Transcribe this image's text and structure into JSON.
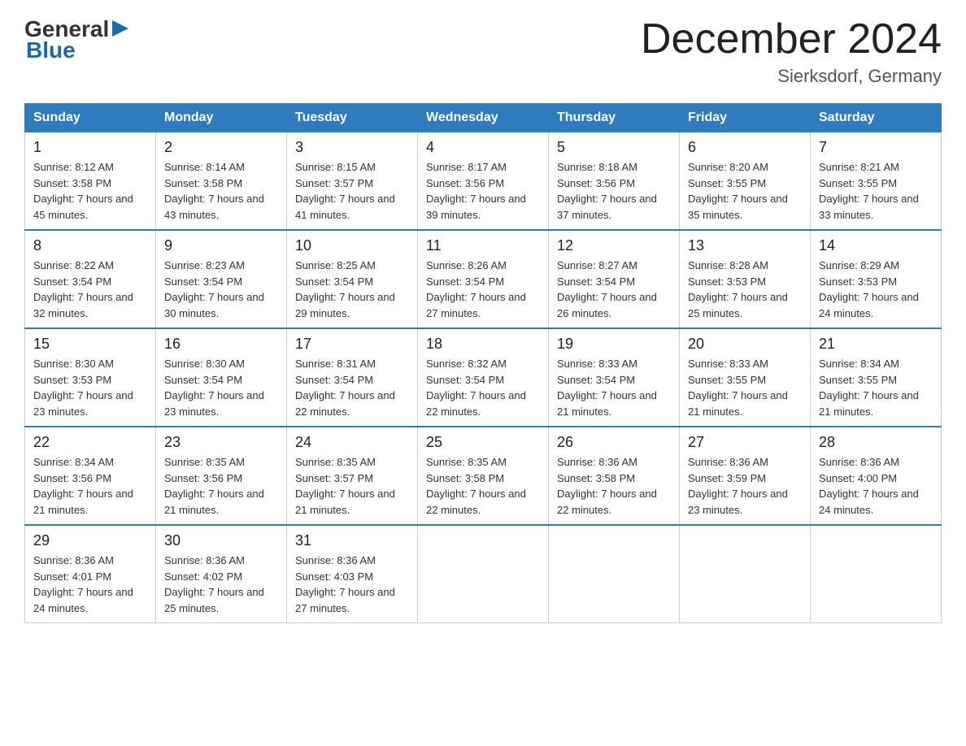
{
  "header": {
    "logo_general": "General",
    "logo_blue": "Blue",
    "title": "December 2024",
    "subtitle": "Sierksdorf, Germany"
  },
  "days_of_week": [
    "Sunday",
    "Monday",
    "Tuesday",
    "Wednesday",
    "Thursday",
    "Friday",
    "Saturday"
  ],
  "weeks": [
    [
      {
        "day": "1",
        "sunrise": "8:12 AM",
        "sunset": "3:58 PM",
        "daylight": "7 hours and 45 minutes."
      },
      {
        "day": "2",
        "sunrise": "8:14 AM",
        "sunset": "3:58 PM",
        "daylight": "7 hours and 43 minutes."
      },
      {
        "day": "3",
        "sunrise": "8:15 AM",
        "sunset": "3:57 PM",
        "daylight": "7 hours and 41 minutes."
      },
      {
        "day": "4",
        "sunrise": "8:17 AM",
        "sunset": "3:56 PM",
        "daylight": "7 hours and 39 minutes."
      },
      {
        "day": "5",
        "sunrise": "8:18 AM",
        "sunset": "3:56 PM",
        "daylight": "7 hours and 37 minutes."
      },
      {
        "day": "6",
        "sunrise": "8:20 AM",
        "sunset": "3:55 PM",
        "daylight": "7 hours and 35 minutes."
      },
      {
        "day": "7",
        "sunrise": "8:21 AM",
        "sunset": "3:55 PM",
        "daylight": "7 hours and 33 minutes."
      }
    ],
    [
      {
        "day": "8",
        "sunrise": "8:22 AM",
        "sunset": "3:54 PM",
        "daylight": "7 hours and 32 minutes."
      },
      {
        "day": "9",
        "sunrise": "8:23 AM",
        "sunset": "3:54 PM",
        "daylight": "7 hours and 30 minutes."
      },
      {
        "day": "10",
        "sunrise": "8:25 AM",
        "sunset": "3:54 PM",
        "daylight": "7 hours and 29 minutes."
      },
      {
        "day": "11",
        "sunrise": "8:26 AM",
        "sunset": "3:54 PM",
        "daylight": "7 hours and 27 minutes."
      },
      {
        "day": "12",
        "sunrise": "8:27 AM",
        "sunset": "3:54 PM",
        "daylight": "7 hours and 26 minutes."
      },
      {
        "day": "13",
        "sunrise": "8:28 AM",
        "sunset": "3:53 PM",
        "daylight": "7 hours and 25 minutes."
      },
      {
        "day": "14",
        "sunrise": "8:29 AM",
        "sunset": "3:53 PM",
        "daylight": "7 hours and 24 minutes."
      }
    ],
    [
      {
        "day": "15",
        "sunrise": "8:30 AM",
        "sunset": "3:53 PM",
        "daylight": "7 hours and 23 minutes."
      },
      {
        "day": "16",
        "sunrise": "8:30 AM",
        "sunset": "3:54 PM",
        "daylight": "7 hours and 23 minutes."
      },
      {
        "day": "17",
        "sunrise": "8:31 AM",
        "sunset": "3:54 PM",
        "daylight": "7 hours and 22 minutes."
      },
      {
        "day": "18",
        "sunrise": "8:32 AM",
        "sunset": "3:54 PM",
        "daylight": "7 hours and 22 minutes."
      },
      {
        "day": "19",
        "sunrise": "8:33 AM",
        "sunset": "3:54 PM",
        "daylight": "7 hours and 21 minutes."
      },
      {
        "day": "20",
        "sunrise": "8:33 AM",
        "sunset": "3:55 PM",
        "daylight": "7 hours and 21 minutes."
      },
      {
        "day": "21",
        "sunrise": "8:34 AM",
        "sunset": "3:55 PM",
        "daylight": "7 hours and 21 minutes."
      }
    ],
    [
      {
        "day": "22",
        "sunrise": "8:34 AM",
        "sunset": "3:56 PM",
        "daylight": "7 hours and 21 minutes."
      },
      {
        "day": "23",
        "sunrise": "8:35 AM",
        "sunset": "3:56 PM",
        "daylight": "7 hours and 21 minutes."
      },
      {
        "day": "24",
        "sunrise": "8:35 AM",
        "sunset": "3:57 PM",
        "daylight": "7 hours and 21 minutes."
      },
      {
        "day": "25",
        "sunrise": "8:35 AM",
        "sunset": "3:58 PM",
        "daylight": "7 hours and 22 minutes."
      },
      {
        "day": "26",
        "sunrise": "8:36 AM",
        "sunset": "3:58 PM",
        "daylight": "7 hours and 22 minutes."
      },
      {
        "day": "27",
        "sunrise": "8:36 AM",
        "sunset": "3:59 PM",
        "daylight": "7 hours and 23 minutes."
      },
      {
        "day": "28",
        "sunrise": "8:36 AM",
        "sunset": "4:00 PM",
        "daylight": "7 hours and 24 minutes."
      }
    ],
    [
      {
        "day": "29",
        "sunrise": "8:36 AM",
        "sunset": "4:01 PM",
        "daylight": "7 hours and 24 minutes."
      },
      {
        "day": "30",
        "sunrise": "8:36 AM",
        "sunset": "4:02 PM",
        "daylight": "7 hours and 25 minutes."
      },
      {
        "day": "31",
        "sunrise": "8:36 AM",
        "sunset": "4:03 PM",
        "daylight": "7 hours and 27 minutes."
      },
      null,
      null,
      null,
      null
    ]
  ],
  "labels": {
    "sunrise": "Sunrise: ",
    "sunset": "Sunset: ",
    "daylight": "Daylight: "
  }
}
